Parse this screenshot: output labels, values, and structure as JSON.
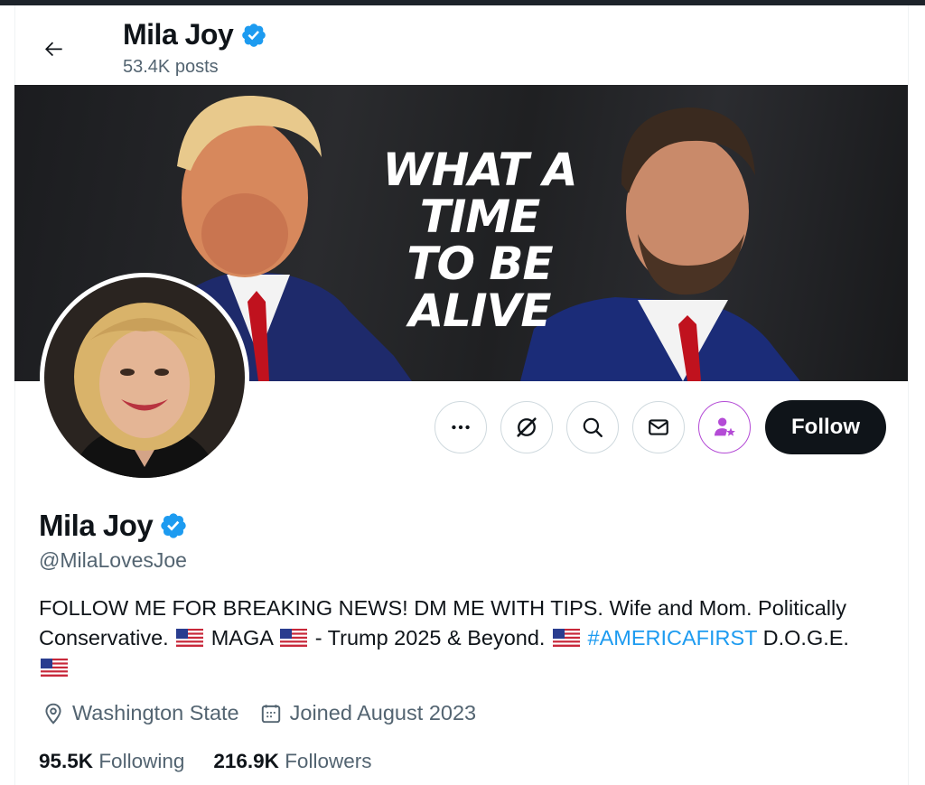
{
  "header": {
    "name": "Mila Joy",
    "posts": "53.4K posts"
  },
  "banner": {
    "text_lines": [
      "WHAT A",
      "TIME",
      "TO BE",
      "ALIVE"
    ]
  },
  "actions": {
    "follow_label": "Follow"
  },
  "profile": {
    "name": "Mila Joy",
    "handle": "@MilaLovesJoe",
    "bio": {
      "part1": "FOLLOW ME FOR BREAKING NEWS!  DM ME WITH TIPS. Wife and Mom. Politically Conservative. ",
      "part2": " MAGA ",
      "part3": " - Trump 2025 & Beyond. ",
      "hashtag": "#AMERICAFIRST",
      "part4": " D.O.G.E."
    },
    "location": "Washington State",
    "joined": "Joined August 2023"
  },
  "stats": {
    "following_count": "95.5K",
    "following_label": "Following",
    "followers_count": "216.9K",
    "followers_label": "Followers"
  },
  "colors": {
    "verified": "#1d9bf0",
    "accent_purple": "#b44bd6",
    "secondary_text": "#536471"
  }
}
